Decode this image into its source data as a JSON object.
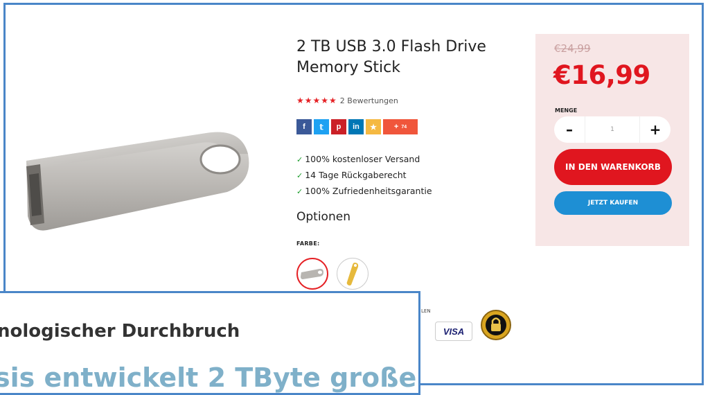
{
  "product": {
    "title": "2 TB USB 3.0 Flash Drive Memory Stick",
    "rating_stars": "★★★★★",
    "rating_text": "2 Bewertungen",
    "benefits": [
      "100% kostenloser Versand",
      "14 Tage Rückgaberecht",
      "100% Zufriedenheitsgarantie"
    ],
    "check_mark": "✓",
    "options_title": "Optionen",
    "color_label": "FARBE:",
    "colors": [
      "silver",
      "gold"
    ]
  },
  "share": {
    "facebook": "f",
    "twitter": "𝕥",
    "pinterest": "p",
    "linkedin": "in",
    "favorite": "★",
    "more": "+",
    "more_count": "74"
  },
  "payment": {
    "label": "LEN",
    "visa": "VISA"
  },
  "buybox": {
    "old_price": "€24,99",
    "new_price": "€16,99",
    "quantity_label": "MENGE",
    "quantity_value": "1",
    "minus": "–",
    "plus": "+",
    "add_to_cart": "IN DEN WARENKORB",
    "buy_now": "JETZT KAUFEN"
  },
  "overlay": {
    "line1": "nologischer Durchbruch",
    "line2": "sis entwickelt 2 TByte große"
  },
  "colors": {
    "accent_red": "#e0161f",
    "buy_blue": "#1e8fd4",
    "buybox_bg": "#f7e6e6",
    "frame_blue": "#4a86c8"
  }
}
